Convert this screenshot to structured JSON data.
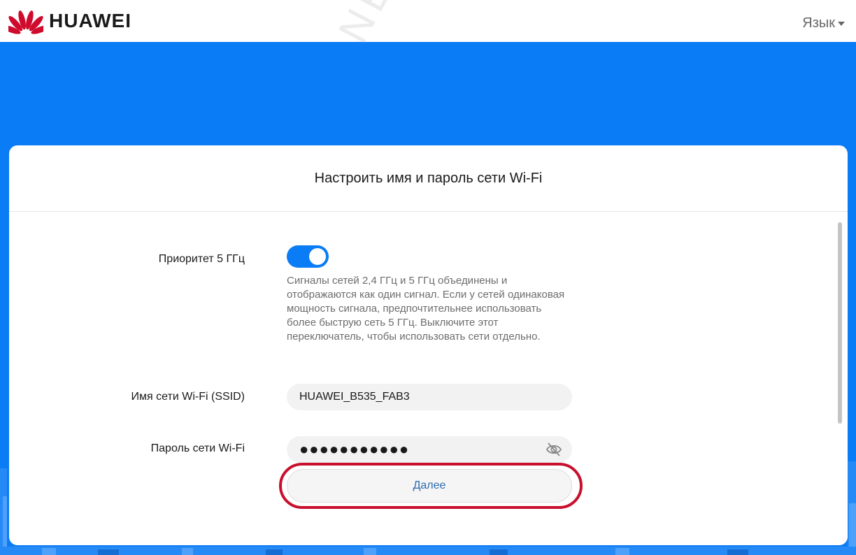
{
  "header": {
    "brand": "HUAWEI",
    "language_label": "Язык"
  },
  "card": {
    "title": "Настроить имя и пароль сети Wi-Fi",
    "priority": {
      "label": "Приоритет 5 ГГц",
      "enabled": true,
      "hint": "Сигналы сетей 2,4 ГГц и 5 ГГц объединены и отображаются как один сигнал. Если у сетей одинаковая мощность сигнала, предпочтительнее использовать более быструю сеть 5 ГГц. Выключите этот переключатель, чтобы использовать сети отдельно."
    },
    "ssid": {
      "label": "Имя сети Wi-Fi (SSID)",
      "value": "HUAWEI_B535_FAB3"
    },
    "password": {
      "label": "Пароль сети Wi-Fi",
      "masked_value": "●●●●●●●●●●●"
    },
    "next_button": "Далее"
  },
  "watermark": "NET-WELL.RU",
  "colors": {
    "accent": "#0a7cf5",
    "highlight": "#c8102e",
    "button_text": "#2b6cb0"
  },
  "icons": {
    "logo": "huawei-petal-icon",
    "language_caret": "caret-down-icon",
    "password_visibility": "eye-slash-icon"
  }
}
